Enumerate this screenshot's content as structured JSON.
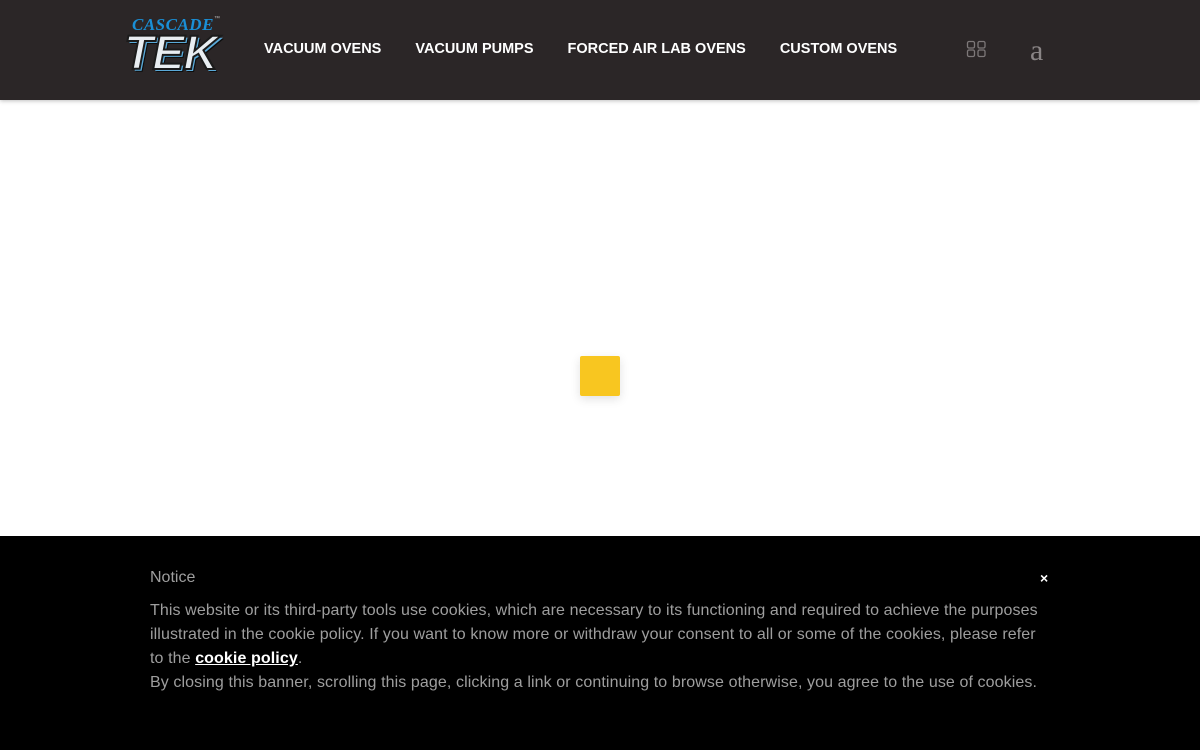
{
  "header": {
    "logo": {
      "top_text": "CASCADE",
      "trademark": "™",
      "main_text": "TEK"
    },
    "nav": [
      {
        "label": "VACUUM OVENS"
      },
      {
        "label": "VACUUM PUMPS"
      },
      {
        "label": "FORCED AIR LAB OVENS"
      },
      {
        "label": "CUSTOM OVENS"
      }
    ],
    "icons": {
      "grid": "grid-icon",
      "search_glyph": "a"
    },
    "background_color": "#2b2627"
  },
  "loader": {
    "color": "#f8c620"
  },
  "cookie_banner": {
    "title": "Notice",
    "close_label": "×",
    "text_part1": "This website or its third-party tools use cookies, which are necessary to its functioning and required to achieve the purposes illustrated in the cookie policy. If you want to know more or withdraw your consent to all or some of the cookies, please refer to the ",
    "link_label": "cookie policy",
    "text_part2": ".",
    "text_line2": "By closing this banner, scrolling this page, clicking a link or continuing to browse otherwise, you agree to the use of cookies.",
    "background_color": "#000000"
  }
}
